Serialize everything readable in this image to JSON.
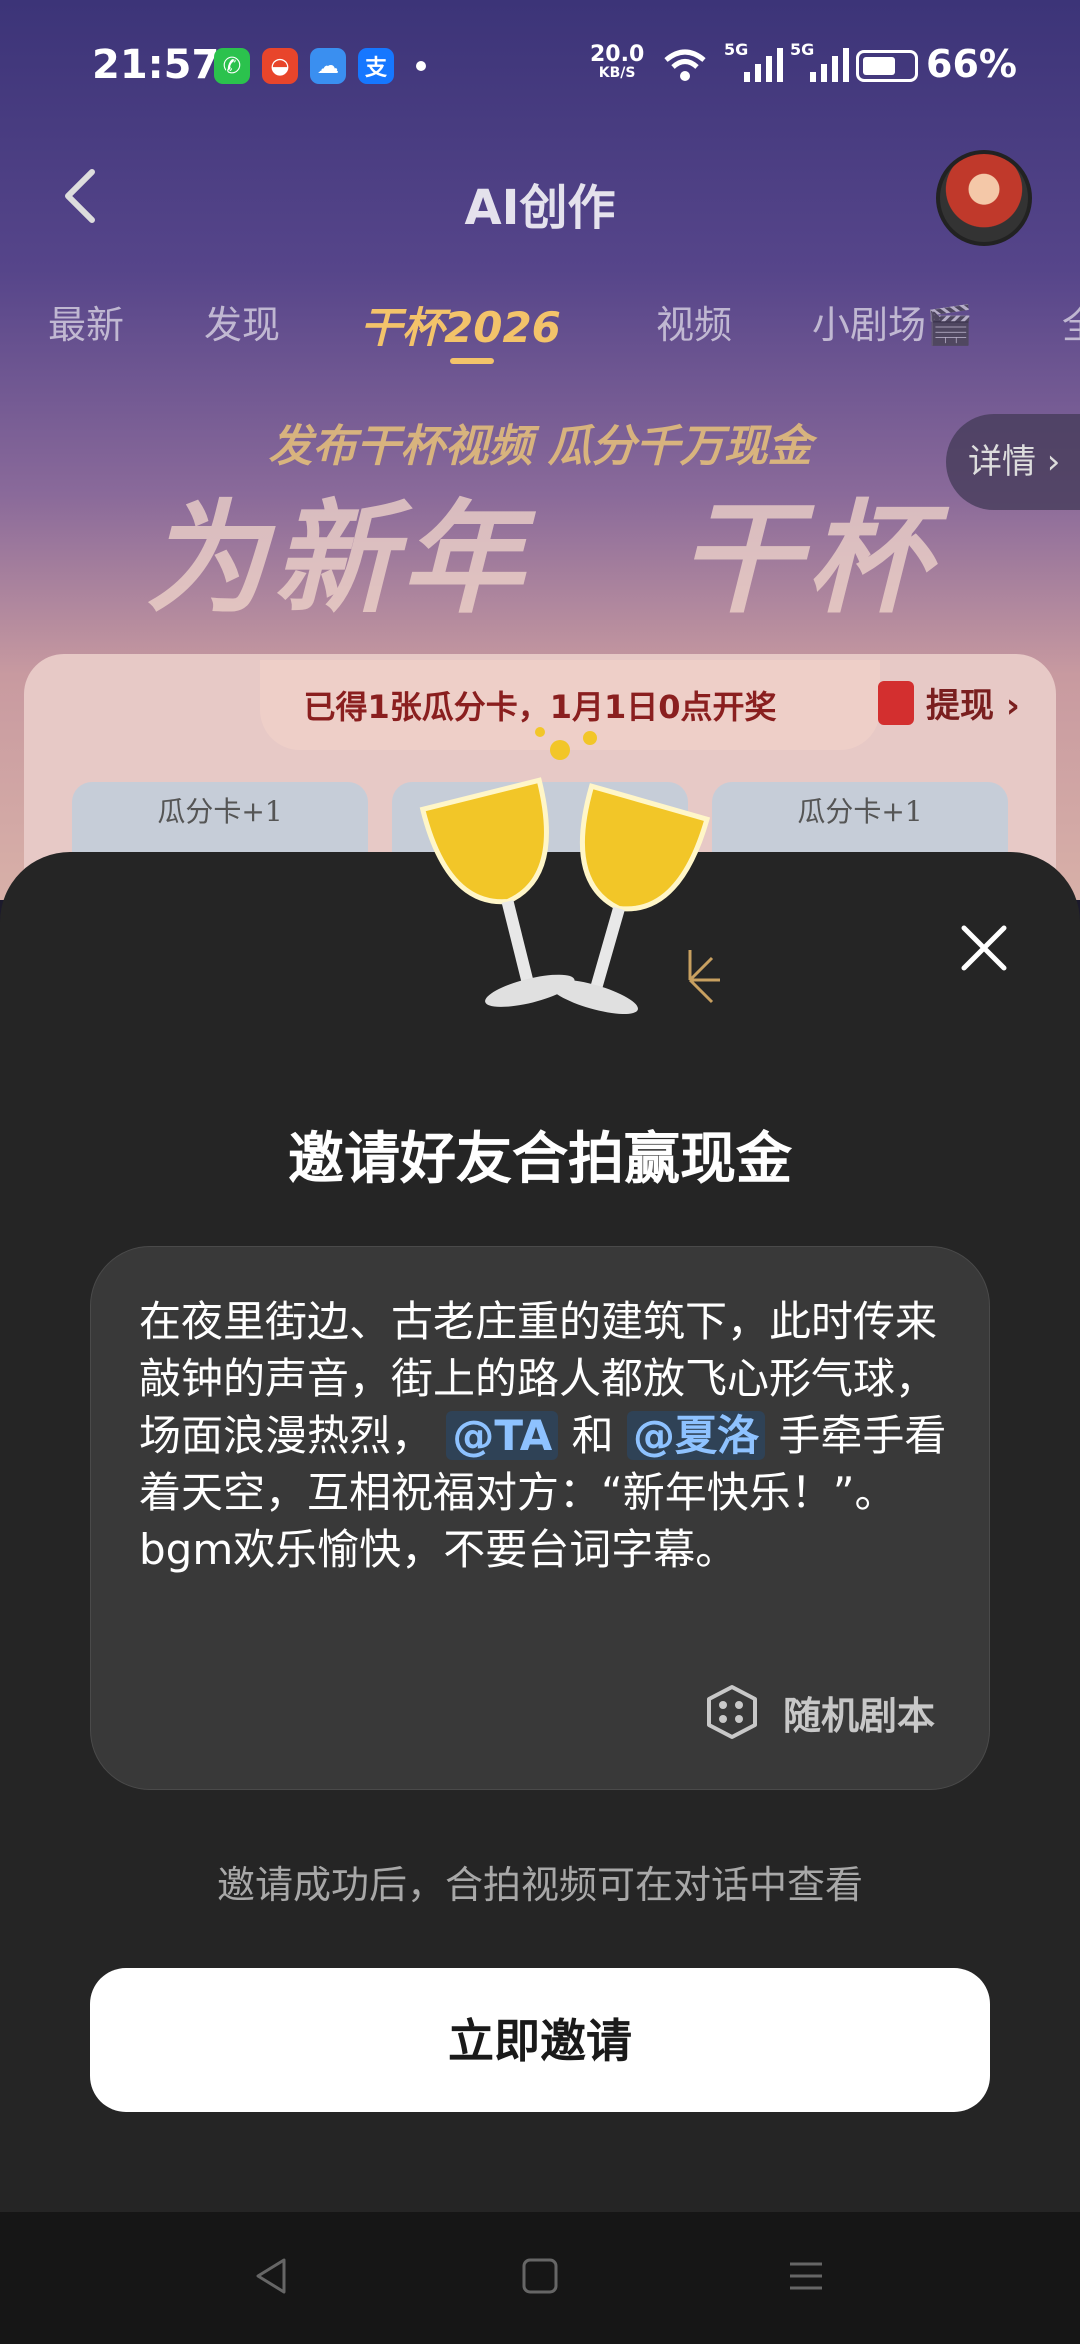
{
  "status_bar": {
    "time": "21:57",
    "net_speed": "20.0",
    "net_speed_unit": "KB/S",
    "signal_1_label": "5G",
    "signal_2_label": "5G",
    "battery_pct": "66%",
    "battery_level": 0.66,
    "app_icons": [
      "wechat-icon",
      "red-app-icon",
      "weather-icon",
      "alipay-icon"
    ]
  },
  "header": {
    "title": "AI创作"
  },
  "tabs": [
    {
      "label": "最新"
    },
    {
      "label": "发现"
    },
    {
      "label": "干杯2026"
    },
    {
      "label": "视频"
    },
    {
      "label": "小剧场🎬"
    },
    {
      "label": "全"
    }
  ],
  "banner": {
    "subtitle": "发布干杯视频 瓜分千万现金",
    "title_left": "为新年",
    "title_right": "干杯",
    "details": "详情 ›"
  },
  "card": {
    "status": "已得1张瓜分卡，1月1日0点开奖",
    "withdraw": "提现 ›",
    "mini_cards": [
      "瓜分卡+1",
      "",
      "瓜分卡+1"
    ]
  },
  "sheet": {
    "title": "邀请好友合拍赢现金",
    "prompt_part1": "在夜里街边、古老庄重的建筑下，此时传来敲钟的声音，街上的路人都放飞心形气球，场面浪漫热烈，",
    "mention_1": "@TA",
    "prompt_part2": "和",
    "mention_2": "@夏洛",
    "prompt_part3": "手牵手看着天空，互相祝福对方：“新年快乐！”。bgm欢乐愉快，不要台词字幕。",
    "random_script": "随机剧本",
    "hint": "邀请成功后，合拍视频可在对话中查看",
    "invite_button": "立即邀请"
  },
  "colors": {
    "accent_gold": "#f3c36a",
    "sheet_bg": "#252525",
    "mention": "#8ec2ff"
  }
}
